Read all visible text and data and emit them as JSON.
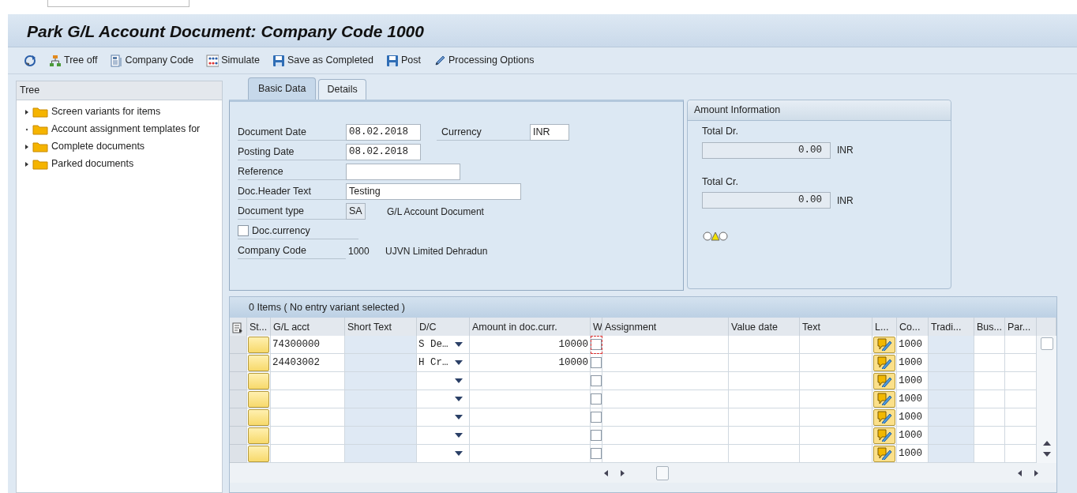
{
  "title": "Park G/L Account Document: Company Code 1000",
  "toolbar": [
    {
      "kind": "refresh"
    },
    {
      "kind": "tree",
      "label": "Tree off"
    },
    {
      "kind": "company",
      "label": "Company Code"
    },
    {
      "kind": "simulate",
      "label": "Simulate"
    },
    {
      "kind": "save",
      "label": "Save as Completed"
    },
    {
      "kind": "save",
      "label": "Post"
    },
    {
      "kind": "pencil",
      "label": "Processing Options"
    }
  ],
  "tree": {
    "title": "Tree",
    "items": [
      {
        "label": "Screen variants for items",
        "expandable": true
      },
      {
        "label": "Account assignment templates for",
        "expandable": false
      },
      {
        "label": "Complete documents",
        "expandable": true
      },
      {
        "label": "Parked documents",
        "expandable": true
      }
    ]
  },
  "tabs": [
    {
      "label": "Basic Data",
      "selected": true
    },
    {
      "label": "Details",
      "selected": false
    }
  ],
  "fields": [
    {
      "kind": "input",
      "label": "Document Date",
      "value": "08.02.2018",
      "extra": {
        "label": "Currency",
        "value": "INR"
      }
    },
    {
      "kind": "input",
      "label": "Posting Date",
      "value": "08.02.2018"
    },
    {
      "kind": "input",
      "label": "Reference"
    },
    {
      "kind": "input",
      "label": "Doc.Header Text",
      "value": "Testing"
    },
    {
      "kind": "readonly",
      "label": "Document type",
      "value": "SA",
      "description": "G/L Account Document"
    },
    {
      "kind": "checkbox",
      "label": "Doc.currency",
      "checked": false
    },
    {
      "kind": "text",
      "label": "Company Code",
      "value": "1000",
      "description": "UJVN Limited Dehradun"
    }
  ],
  "amount_info": {
    "title": "Amount Information",
    "totals": [
      {
        "label": "Total Dr.",
        "value": "0.00",
        "currency": "INR"
      },
      {
        "label": "Total Cr.",
        "value": "0.00",
        "currency": "INR"
      }
    ]
  },
  "table": {
    "title": "0 Items ( No entry variant selected )",
    "columns": [
      "St...",
      "G/L acct",
      "Short Text",
      "D/C",
      "Amount in doc.curr.",
      "W",
      "Assignment",
      "Value date",
      "Text",
      "L...",
      "Co...",
      "Tradi...",
      "Bus...",
      "Par..."
    ],
    "rows": [
      {
        "gl_acct": "74300000",
        "dc": "S De…",
        "amount": "10000",
        "checked": false,
        "focused": true,
        "co": "1000"
      },
      {
        "gl_acct": "24403002",
        "dc": "H Cr…",
        "amount": "10000",
        "checked": false,
        "focused": false,
        "co": "1000"
      },
      {
        "checked": false,
        "focused": false,
        "co": "1000"
      },
      {
        "checked": false,
        "focused": false,
        "co": "1000"
      },
      {
        "checked": false,
        "focused": false,
        "co": "1000"
      },
      {
        "checked": false,
        "focused": false,
        "co": "1000"
      },
      {
        "checked": false,
        "focused": false,
        "co": "1000"
      }
    ]
  }
}
